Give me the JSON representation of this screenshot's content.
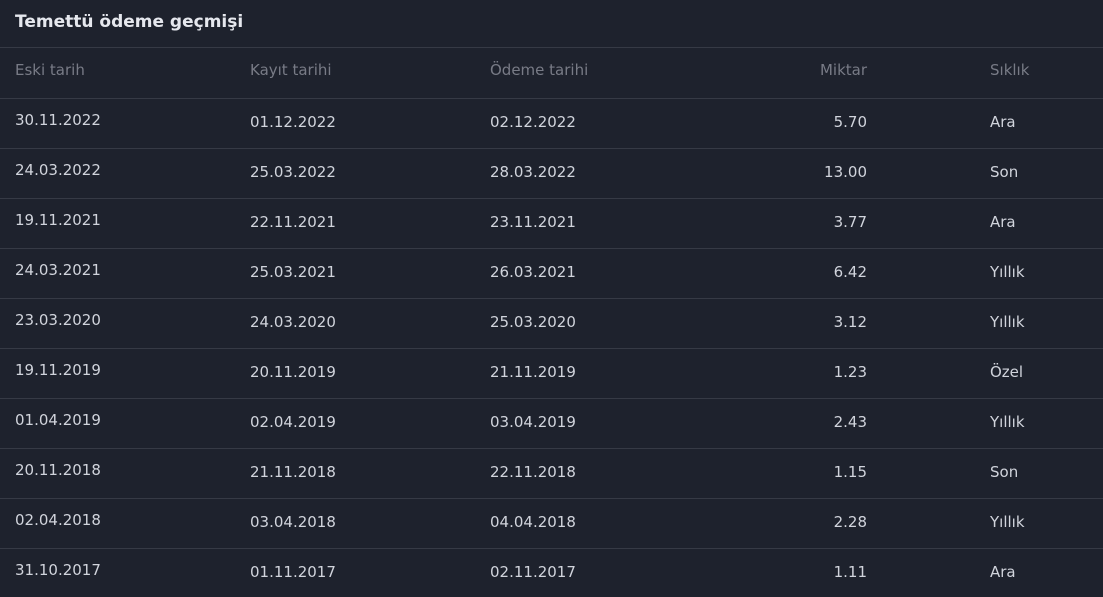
{
  "panel": {
    "title": "Temettü ödeme geçmişi"
  },
  "table": {
    "headers": [
      "Eski tarih",
      "Kayıt tarihi",
      "Ödeme tarihi",
      "Miktar",
      "Sıklık"
    ],
    "rows": [
      [
        "30.11.2022",
        "01.12.2022",
        "02.12.2022",
        "5.70",
        "Ara"
      ],
      [
        "24.03.2022",
        "25.03.2022",
        "28.03.2022",
        "13.00",
        "Son"
      ],
      [
        "19.11.2021",
        "22.11.2021",
        "23.11.2021",
        "3.77",
        "Ara"
      ],
      [
        "24.03.2021",
        "25.03.2021",
        "26.03.2021",
        "6.42",
        "Yıllık"
      ],
      [
        "23.03.2020",
        "24.03.2020",
        "25.03.2020",
        "3.12",
        "Yıllık"
      ],
      [
        "19.11.2019",
        "20.11.2019",
        "21.11.2019",
        "1.23",
        "Özel"
      ],
      [
        "01.04.2019",
        "02.04.2019",
        "03.04.2019",
        "2.43",
        "Yıllık"
      ],
      [
        "20.11.2018",
        "21.11.2018",
        "22.11.2018",
        "1.15",
        "Son"
      ],
      [
        "02.04.2018",
        "03.04.2018",
        "04.04.2018",
        "2.28",
        "Yıllık"
      ],
      [
        "31.10.2017",
        "01.11.2017",
        "02.11.2017",
        "1.11",
        "Ara"
      ]
    ]
  },
  "colors": {
    "background": "#1e222d",
    "divider": "#363a45",
    "header_text": "#787b86",
    "cell_text": "#d1d4dc"
  }
}
